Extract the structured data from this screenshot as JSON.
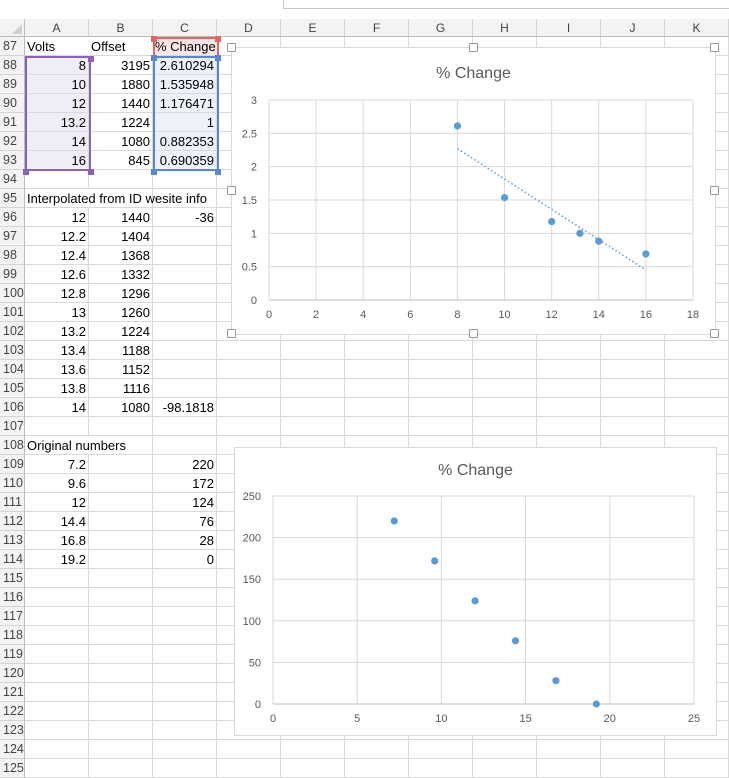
{
  "columns": [
    "A",
    "B",
    "C",
    "D",
    "E",
    "F",
    "G",
    "H",
    "I",
    "J",
    "K"
  ],
  "rows": [
    {
      "n": "87",
      "A": "Volts",
      "B": "Offset",
      "C": "% Change"
    },
    {
      "n": "88",
      "A": "8",
      "B": "3195",
      "C": "2.610294"
    },
    {
      "n": "89",
      "A": "10",
      "B": "1880",
      "C": "1.535948"
    },
    {
      "n": "90",
      "A": "12",
      "B": "1440",
      "C": "1.176471"
    },
    {
      "n": "91",
      "A": "13.2",
      "B": "1224",
      "C": "1"
    },
    {
      "n": "92",
      "A": "14",
      "B": "1080",
      "C": "0.882353"
    },
    {
      "n": "93",
      "A": "16",
      "B": "845",
      "C": "0.690359"
    },
    {
      "n": "94"
    },
    {
      "n": "95",
      "A": "Interpolated from ID wesite info"
    },
    {
      "n": "96",
      "A": "12",
      "B": "1440",
      "C": "-36"
    },
    {
      "n": "97",
      "A": "12.2",
      "B": "1404"
    },
    {
      "n": "98",
      "A": "12.4",
      "B": "1368"
    },
    {
      "n": "99",
      "A": "12.6",
      "B": "1332"
    },
    {
      "n": "100",
      "A": "12.8",
      "B": "1296"
    },
    {
      "n": "101",
      "A": "13",
      "B": "1260"
    },
    {
      "n": "102",
      "A": "13.2",
      "B": "1224"
    },
    {
      "n": "103",
      "A": "13.4",
      "B": "1188"
    },
    {
      "n": "104",
      "A": "13.6",
      "B": "1152"
    },
    {
      "n": "105",
      "A": "13.8",
      "B": "1116"
    },
    {
      "n": "106",
      "A": "14",
      "B": "1080",
      "C": "-98.1818"
    },
    {
      "n": "107"
    },
    {
      "n": "108",
      "A": "Original numbers"
    },
    {
      "n": "109",
      "A": "7.2",
      "C": "220"
    },
    {
      "n": "110",
      "A": "9.6",
      "C": "172"
    },
    {
      "n": "111",
      "A": "12",
      "C": "124"
    },
    {
      "n": "112",
      "A": "14.4",
      "C": "76"
    },
    {
      "n": "113",
      "A": "16.8",
      "C": "28"
    },
    {
      "n": "114",
      "A": "19.2",
      "C": "0"
    },
    {
      "n": "115"
    },
    {
      "n": "116"
    },
    {
      "n": "117"
    },
    {
      "n": "118"
    },
    {
      "n": "119"
    },
    {
      "n": "120"
    },
    {
      "n": "121"
    },
    {
      "n": "122"
    },
    {
      "n": "123"
    },
    {
      "n": "124"
    },
    {
      "n": "125"
    }
  ],
  "colors": {
    "series": "#5b9bd5",
    "grid": "#d9d9d9",
    "selA": "#8a62b8",
    "selC": "#5b86d6",
    "selHeader": "#e06666"
  },
  "chart_data": [
    {
      "type": "scatter",
      "title": "% Change",
      "x": [
        8,
        10,
        12,
        13.2,
        14,
        16
      ],
      "y": [
        2.610294,
        1.535948,
        1.176471,
        1,
        0.882353,
        0.690359
      ],
      "xlim": [
        0,
        18
      ],
      "ylim": [
        0,
        3
      ],
      "xticks": [
        "0",
        "2",
        "4",
        "6",
        "8",
        "10",
        "12",
        "14",
        "16",
        "18"
      ],
      "yticks": [
        "0",
        "0.5",
        "1",
        "1.5",
        "2",
        "2.5",
        "3"
      ],
      "trendline": {
        "type": "linear",
        "x": [
          8,
          16
        ],
        "y": [
          2.27,
          0.45
        ]
      },
      "grid": true,
      "legend": "none"
    },
    {
      "type": "scatter",
      "title": "% Change",
      "x": [
        7.2,
        9.6,
        12,
        14.4,
        16.8,
        19.2
      ],
      "y": [
        220,
        172,
        124,
        76,
        28,
        0
      ],
      "xlim": [
        0,
        25
      ],
      "ylim": [
        0,
        250
      ],
      "xticks": [
        "0",
        "5",
        "10",
        "15",
        "20",
        "25"
      ],
      "yticks": [
        "0",
        "50",
        "100",
        "150",
        "200",
        "250"
      ],
      "grid": true,
      "legend": "none"
    }
  ]
}
